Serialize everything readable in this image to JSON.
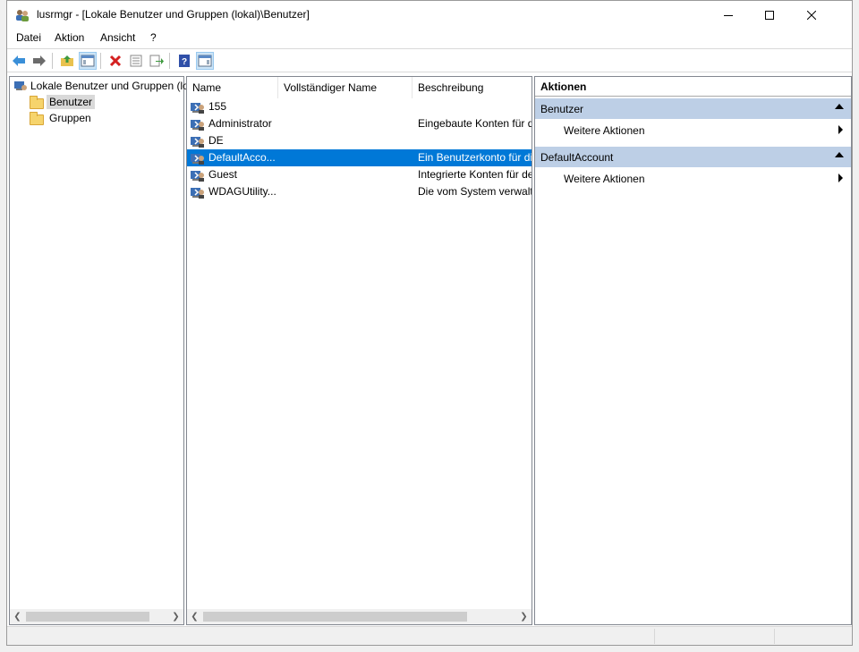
{
  "window": {
    "title": "lusrmgr - [Lokale Benutzer und Gruppen (lokal)\\Benutzer]",
    "controls": [
      "minimize-icon",
      "maximize-icon",
      "close-icon"
    ]
  },
  "menu": {
    "items": [
      "Datei",
      "Aktion",
      "Ansicht",
      "?"
    ]
  },
  "toolbar": {
    "buttons": [
      "back-icon",
      "forward-icon",
      "up-folder-icon",
      "show-tree-icon",
      "delete-icon",
      "properties-icon",
      "export-icon",
      "help-icon",
      "show-actions-icon"
    ]
  },
  "tree": {
    "root": "Lokale Benutzer und Gruppen (lo",
    "children": [
      {
        "label": "Benutzer",
        "selected": true
      },
      {
        "label": "Gruppen",
        "selected": false
      }
    ]
  },
  "list": {
    "columns": [
      "Name",
      "Vollständiger Name",
      "Beschreibung"
    ],
    "rows": [
      {
        "name": "155",
        "fullname": "",
        "description": ""
      },
      {
        "name": "Administrator",
        "fullname": "",
        "description": "Eingebaute Konten für d"
      },
      {
        "name": "DE",
        "fullname": "",
        "description": ""
      },
      {
        "name": "DefaultAcco...",
        "fullname": "",
        "description": "Ein Benutzerkonto für di",
        "selected": true
      },
      {
        "name": "Guest",
        "fullname": "",
        "description": "Integrierte Konten für de"
      },
      {
        "name": "WDAGUtility...",
        "fullname": "",
        "description": "Die vom System verwalt"
      }
    ]
  },
  "actions": {
    "header": "Aktionen",
    "groups": [
      {
        "title": "Benutzer",
        "items": [
          "Weitere Aktionen"
        ]
      },
      {
        "title": "DefaultAccount",
        "items": [
          "Weitere Aktionen"
        ]
      }
    ]
  },
  "colors": {
    "selection": "#0078d7",
    "action_group": "#bdcfe6",
    "tree_selection": "#d9d9d9"
  }
}
